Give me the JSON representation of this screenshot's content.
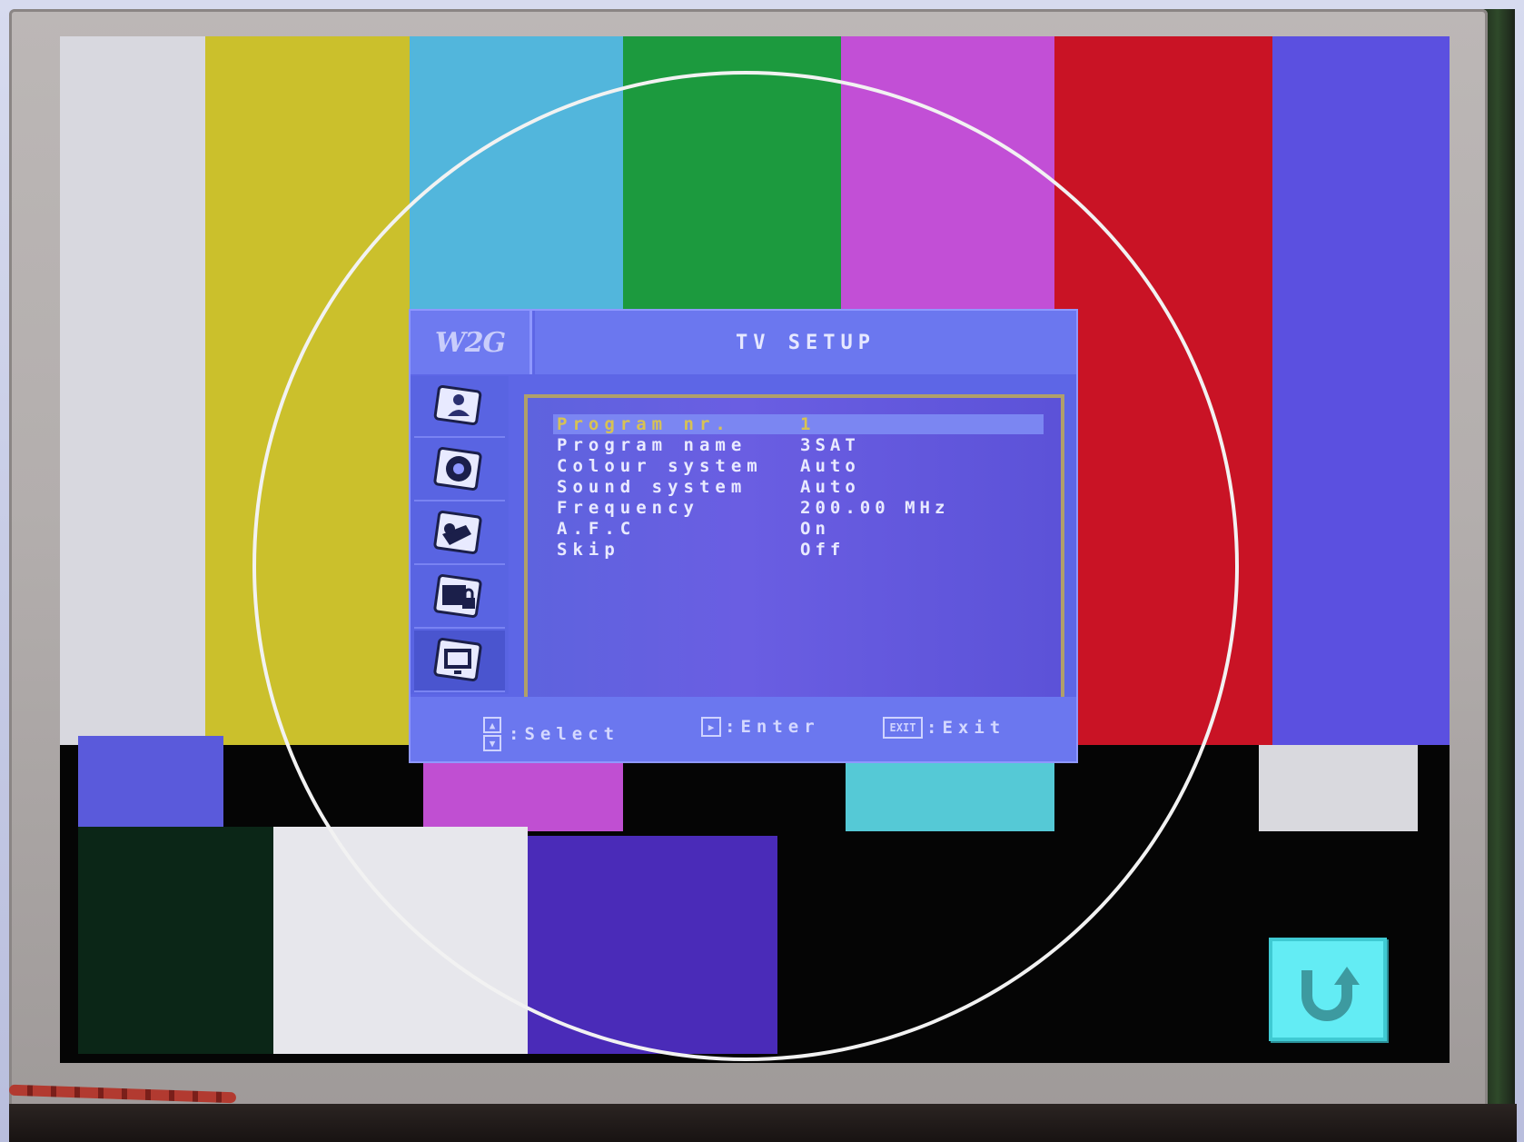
{
  "osd": {
    "logo": "W2G",
    "title": "TV SETUP",
    "sidebar_icons": [
      "picture-icon",
      "sound-icon",
      "tools-icon",
      "lock-icon",
      "tv-setup-icon"
    ],
    "rows": [
      {
        "label": "Program nr.",
        "value": "1"
      },
      {
        "label": "Program name",
        "value": "3SAT"
      },
      {
        "label": "Colour system",
        "value": "Auto"
      },
      {
        "label": "Sound system",
        "value": "Auto"
      },
      {
        "label": "Frequency",
        "value": "200.00 MHz"
      },
      {
        "label": "A.F.C",
        "value": "On"
      },
      {
        "label": "Skip",
        "value": "Off"
      }
    ],
    "selected_row": 0,
    "footer": {
      "select": ":Select",
      "enter": ":Enter",
      "exit_key": "EXIT",
      "exit": ":Exit"
    }
  },
  "overlay": {
    "return_icon": "return-arrow-icon",
    "return_color": "#63ecf4"
  },
  "test_pattern_colors": {
    "white": "#d8d8df",
    "yellow": "#cbc02c",
    "cyan": "#52b6dc",
    "green": "#1c9a3e",
    "magenta": "#c24fd6",
    "red": "#c91325",
    "blue": "#5b50e0"
  }
}
